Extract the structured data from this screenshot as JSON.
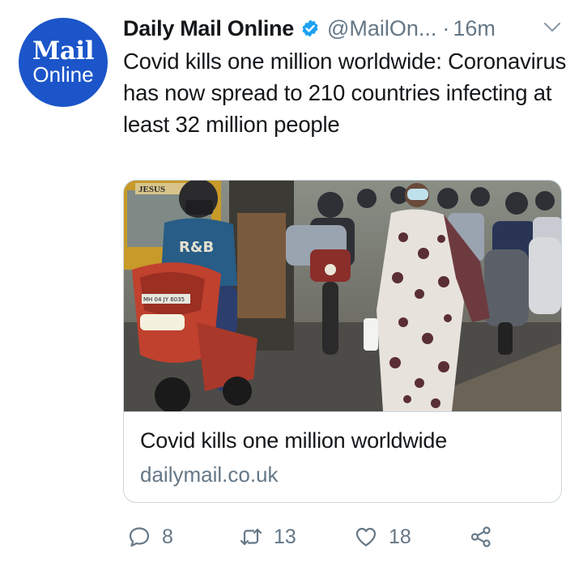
{
  "tweet": {
    "avatar": {
      "line1": "Mail",
      "line2": "Online"
    },
    "author_name": "Daily Mail Online",
    "handle": "@MailOn...",
    "separator": "·",
    "time": "16m",
    "text": "Covid kills one million worldwide: Coronavirus has now spread to 210 countries infecting at least 32 million people"
  },
  "card": {
    "title": "Covid kills one million worldwide",
    "domain": "dailymail.co.uk",
    "photo_signs": {
      "bus_sign": "JESUS",
      "shirt_text": "R&B",
      "plate": "MH 04 JY 6035"
    }
  },
  "actions": {
    "replies": "8",
    "retweets": "13",
    "likes": "18"
  },
  "colors": {
    "brand_blue": "#1b55c9",
    "verified_blue": "#1da1f2",
    "secondary_text": "#657786",
    "border": "#ccd6dd"
  }
}
